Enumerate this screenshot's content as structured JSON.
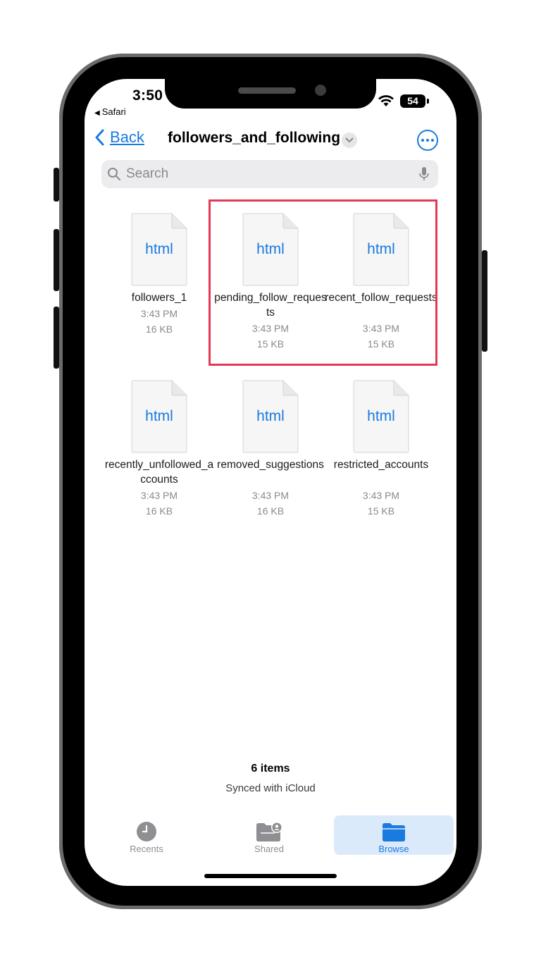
{
  "status_bar": {
    "time": "3:50",
    "back_app": "Safari",
    "battery": "54"
  },
  "navbar": {
    "back_label": "Back",
    "title": "followers_and_following"
  },
  "search": {
    "placeholder": "Search"
  },
  "files": [
    {
      "type_label": "html",
      "name": "followers_1",
      "time": "3:43 PM",
      "size": "16 KB"
    },
    {
      "type_label": "html",
      "name": "pending_follow_requests",
      "time": "3:43 PM",
      "size": "15 KB"
    },
    {
      "type_label": "html",
      "name": "recent_follow_requests",
      "time": "3:43 PM",
      "size": "15 KB"
    },
    {
      "type_label": "html",
      "name": "recently_unfollowed_accounts",
      "time": "3:43 PM",
      "size": "16 KB"
    },
    {
      "type_label": "html",
      "name": "removed_suggestions",
      "time": "3:43 PM",
      "size": "16 KB"
    },
    {
      "type_label": "html",
      "name": "restricted_accounts",
      "time": "3:43 PM",
      "size": "15 KB"
    }
  ],
  "footer": {
    "count": "6 items",
    "sync": "Synced with iCloud"
  },
  "tabs": {
    "recents": "Recents",
    "shared": "Shared",
    "browse": "Browse"
  },
  "colors": {
    "accent": "#1a7ae0",
    "highlight": "#e23a55",
    "selected_tab_bg": "#dbeafb"
  }
}
